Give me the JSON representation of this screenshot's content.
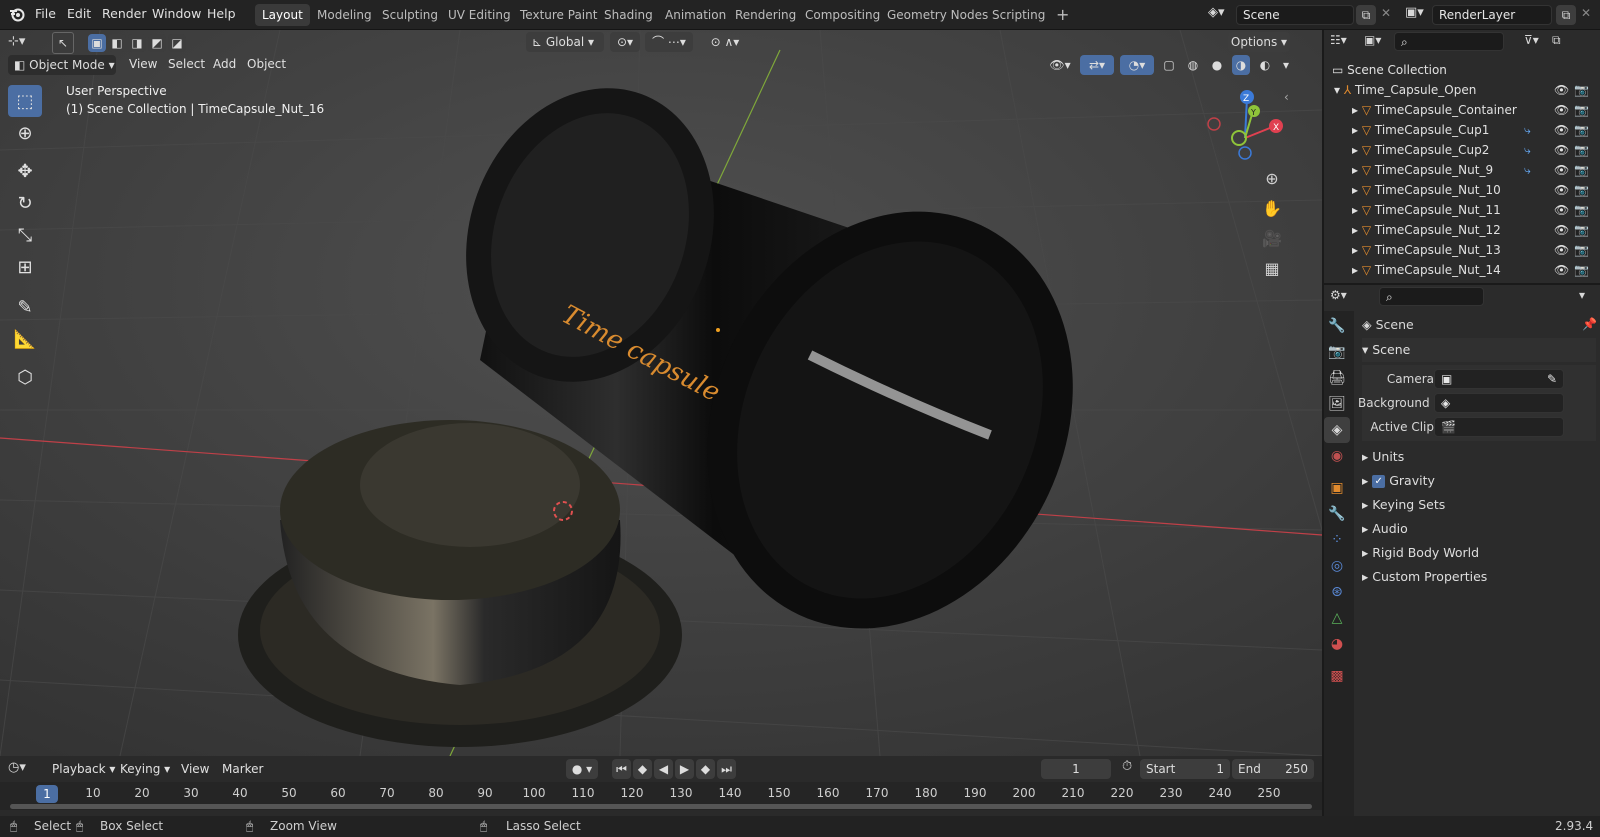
{
  "menu": [
    "File",
    "Edit",
    "Render",
    "Window",
    "Help"
  ],
  "workspaces": [
    "Layout",
    "Modeling",
    "Sculpting",
    "UV Editing",
    "Texture Paint",
    "Shading",
    "Animation",
    "Rendering",
    "Compositing",
    "Geometry Nodes",
    "Scripting"
  ],
  "active_workspace": "Layout",
  "scene_name": "Scene",
  "view_layer": "RenderLayer",
  "viewport": {
    "mode": "Object Mode",
    "menus": [
      "View",
      "Select",
      "Add",
      "Object"
    ],
    "transform_orientation": "Global",
    "options_label": "Options",
    "overlay_line1": "User Perspective",
    "overlay_line2": "(1) Scene Collection | TimeCapsule_Nut_16",
    "object_text": "Time capsule",
    "gizmo": {
      "z": "Z",
      "y": "Y",
      "x": "X"
    }
  },
  "outliner": {
    "root": "Scene Collection",
    "items": [
      {
        "name": "Time_Capsule_Open"
      },
      {
        "name": "TimeCapsule_Container"
      },
      {
        "name": "TimeCapsule_Cup1"
      },
      {
        "name": "TimeCapsule_Cup2"
      },
      {
        "name": "TimeCapsule_Nut_9"
      },
      {
        "name": "TimeCapsule_Nut_10"
      },
      {
        "name": "TimeCapsule_Nut_11"
      },
      {
        "name": "TimeCapsule_Nut_12"
      },
      {
        "name": "TimeCapsule_Nut_13"
      },
      {
        "name": "TimeCapsule_Nut_14"
      }
    ]
  },
  "properties": {
    "context": "Scene",
    "panel_title": "Scene",
    "camera_label": "Camera",
    "background_label": "Background Sce...",
    "active_clip_label": "Active Clip",
    "subpanels": [
      "Units",
      "Gravity",
      "Keying Sets",
      "Audio",
      "Rigid Body World",
      "Custom Properties"
    ],
    "gravity_checked": true
  },
  "timeline": {
    "menus": [
      "Playback",
      "Keying",
      "View",
      "Marker"
    ],
    "current_frame": "1",
    "start_label": "Start",
    "start": "1",
    "end_label": "End",
    "end": "250",
    "ruler": [
      "1",
      "10",
      "20",
      "30",
      "40",
      "50",
      "60",
      "70",
      "80",
      "90",
      "100",
      "110",
      "120",
      "130",
      "140",
      "150",
      "160",
      "170",
      "180",
      "190",
      "200",
      "210",
      "220",
      "230",
      "240",
      "250"
    ]
  },
  "status": {
    "select": "Select",
    "box_select": "Box Select",
    "zoom_view": "Zoom View",
    "lasso_select": "Lasso Select",
    "version": "2.93.4"
  },
  "colors": {
    "accent": "#4b6ea3",
    "x_axis": "#e04050",
    "y_axis": "#8fc43a",
    "z_axis": "#3b7ad8",
    "text_orange": "#d98b2f"
  }
}
